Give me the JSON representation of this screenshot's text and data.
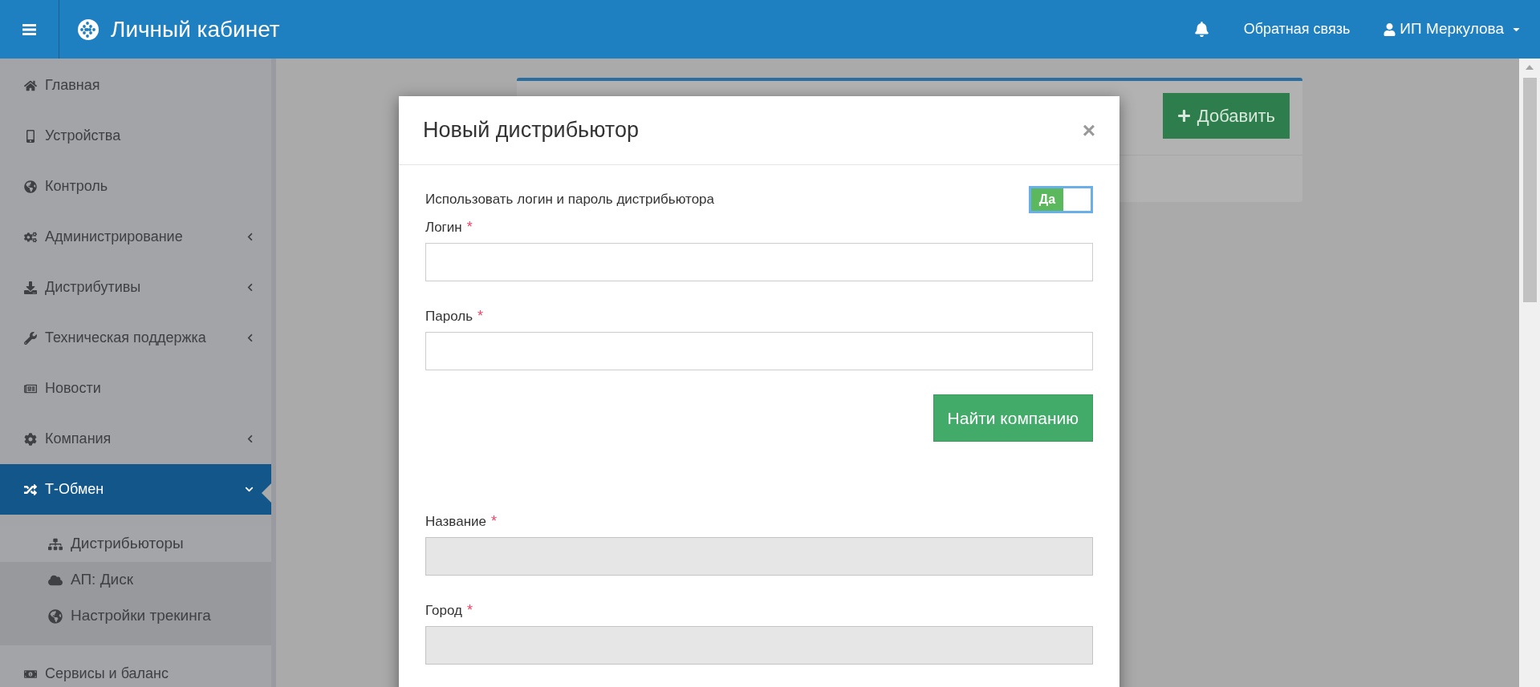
{
  "header": {
    "title": "Личный кабинет",
    "links": [
      {
        "label": "Обратная связь"
      }
    ],
    "user": "ИП Меркулова"
  },
  "sidebar": {
    "items": [
      {
        "label": "Главная",
        "selected": false
      },
      {
        "label": "Устройства",
        "selected": false
      },
      {
        "label": "Контроль",
        "selected": false
      },
      {
        "label": "Администрирование",
        "selected": false,
        "expanded": false
      },
      {
        "label": "Дистрибутивы",
        "selected": false,
        "expanded": false
      },
      {
        "label": "Техническая поддержка",
        "selected": false,
        "expanded": false
      },
      {
        "label": "Новости",
        "selected": false
      },
      {
        "label": "Компания",
        "selected": false,
        "expanded": false
      },
      {
        "label": "Т-Обмен",
        "selected": true,
        "expanded": true,
        "children": [
          {
            "label": "Дистрибьюторы",
            "selected": true
          },
          {
            "label": "АП: Диск",
            "selected": false
          },
          {
            "label": "Настройки трекинга",
            "selected": false
          }
        ]
      },
      {
        "label": "Сервисы и баланс",
        "selected": false
      }
    ]
  },
  "card": {
    "add_button": "Добавить"
  },
  "modal": {
    "title": "Новый дистрибьютор",
    "close": "×",
    "toggle": {
      "label": "Использовать логин и пароль дистрибьютора",
      "on": true,
      "text": "Да"
    },
    "fields": [
      {
        "label": "Логин",
        "required_mark": "*",
        "disabled": false
      },
      {
        "label": "Пароль",
        "required_mark": "*",
        "disabled": false
      },
      {
        "kind": "button",
        "label": "Найти компанию"
      },
      {
        "label": "Название",
        "required_mark": "*",
        "disabled": true
      },
      {
        "label": "Город",
        "required_mark": "*",
        "disabled": true
      }
    ]
  }
}
